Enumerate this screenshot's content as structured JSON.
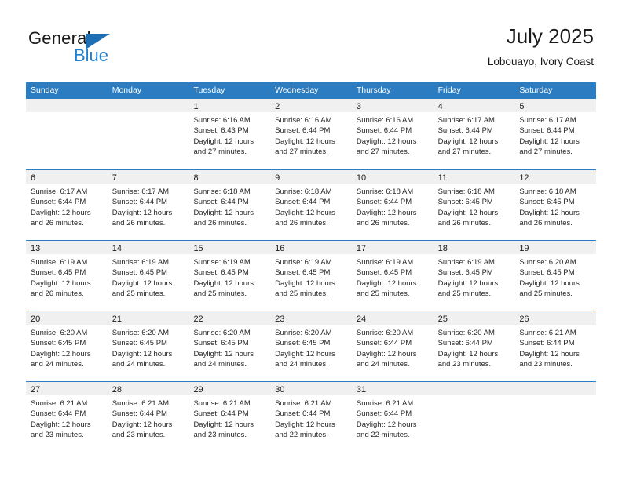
{
  "brand": {
    "name_top": "General",
    "name_bottom": "Blue",
    "triangle_icon": "triangle-icon",
    "color_black": "#1a1a1a",
    "color_blue": "#1f7fd0"
  },
  "header": {
    "title": "July 2025",
    "subtitle": "Lobouayo, Ivory Coast"
  },
  "theme": {
    "header_blue": "#2b7cc0",
    "day_band_gray": "#f0f0f0",
    "text": "#262626"
  },
  "calendar": {
    "weekdays": [
      "Sunday",
      "Monday",
      "Tuesday",
      "Wednesday",
      "Thursday",
      "Friday",
      "Saturday"
    ],
    "weeks": [
      [
        {
          "day": "",
          "lines": []
        },
        {
          "day": "",
          "lines": []
        },
        {
          "day": "1",
          "lines": [
            "Sunrise: 6:16 AM",
            "Sunset: 6:43 PM",
            "Daylight: 12 hours",
            "and 27 minutes."
          ]
        },
        {
          "day": "2",
          "lines": [
            "Sunrise: 6:16 AM",
            "Sunset: 6:44 PM",
            "Daylight: 12 hours",
            "and 27 minutes."
          ]
        },
        {
          "day": "3",
          "lines": [
            "Sunrise: 6:16 AM",
            "Sunset: 6:44 PM",
            "Daylight: 12 hours",
            "and 27 minutes."
          ]
        },
        {
          "day": "4",
          "lines": [
            "Sunrise: 6:17 AM",
            "Sunset: 6:44 PM",
            "Daylight: 12 hours",
            "and 27 minutes."
          ]
        },
        {
          "day": "5",
          "lines": [
            "Sunrise: 6:17 AM",
            "Sunset: 6:44 PM",
            "Daylight: 12 hours",
            "and 27 minutes."
          ]
        }
      ],
      [
        {
          "day": "6",
          "lines": [
            "Sunrise: 6:17 AM",
            "Sunset: 6:44 PM",
            "Daylight: 12 hours",
            "and 26 minutes."
          ]
        },
        {
          "day": "7",
          "lines": [
            "Sunrise: 6:17 AM",
            "Sunset: 6:44 PM",
            "Daylight: 12 hours",
            "and 26 minutes."
          ]
        },
        {
          "day": "8",
          "lines": [
            "Sunrise: 6:18 AM",
            "Sunset: 6:44 PM",
            "Daylight: 12 hours",
            "and 26 minutes."
          ]
        },
        {
          "day": "9",
          "lines": [
            "Sunrise: 6:18 AM",
            "Sunset: 6:44 PM",
            "Daylight: 12 hours",
            "and 26 minutes."
          ]
        },
        {
          "day": "10",
          "lines": [
            "Sunrise: 6:18 AM",
            "Sunset: 6:44 PM",
            "Daylight: 12 hours",
            "and 26 minutes."
          ]
        },
        {
          "day": "11",
          "lines": [
            "Sunrise: 6:18 AM",
            "Sunset: 6:45 PM",
            "Daylight: 12 hours",
            "and 26 minutes."
          ]
        },
        {
          "day": "12",
          "lines": [
            "Sunrise: 6:18 AM",
            "Sunset: 6:45 PM",
            "Daylight: 12 hours",
            "and 26 minutes."
          ]
        }
      ],
      [
        {
          "day": "13",
          "lines": [
            "Sunrise: 6:19 AM",
            "Sunset: 6:45 PM",
            "Daylight: 12 hours",
            "and 26 minutes."
          ]
        },
        {
          "day": "14",
          "lines": [
            "Sunrise: 6:19 AM",
            "Sunset: 6:45 PM",
            "Daylight: 12 hours",
            "and 25 minutes."
          ]
        },
        {
          "day": "15",
          "lines": [
            "Sunrise: 6:19 AM",
            "Sunset: 6:45 PM",
            "Daylight: 12 hours",
            "and 25 minutes."
          ]
        },
        {
          "day": "16",
          "lines": [
            "Sunrise: 6:19 AM",
            "Sunset: 6:45 PM",
            "Daylight: 12 hours",
            "and 25 minutes."
          ]
        },
        {
          "day": "17",
          "lines": [
            "Sunrise: 6:19 AM",
            "Sunset: 6:45 PM",
            "Daylight: 12 hours",
            "and 25 minutes."
          ]
        },
        {
          "day": "18",
          "lines": [
            "Sunrise: 6:19 AM",
            "Sunset: 6:45 PM",
            "Daylight: 12 hours",
            "and 25 minutes."
          ]
        },
        {
          "day": "19",
          "lines": [
            "Sunrise: 6:20 AM",
            "Sunset: 6:45 PM",
            "Daylight: 12 hours",
            "and 25 minutes."
          ]
        }
      ],
      [
        {
          "day": "20",
          "lines": [
            "Sunrise: 6:20 AM",
            "Sunset: 6:45 PM",
            "Daylight: 12 hours",
            "and 24 minutes."
          ]
        },
        {
          "day": "21",
          "lines": [
            "Sunrise: 6:20 AM",
            "Sunset: 6:45 PM",
            "Daylight: 12 hours",
            "and 24 minutes."
          ]
        },
        {
          "day": "22",
          "lines": [
            "Sunrise: 6:20 AM",
            "Sunset: 6:45 PM",
            "Daylight: 12 hours",
            "and 24 minutes."
          ]
        },
        {
          "day": "23",
          "lines": [
            "Sunrise: 6:20 AM",
            "Sunset: 6:45 PM",
            "Daylight: 12 hours",
            "and 24 minutes."
          ]
        },
        {
          "day": "24",
          "lines": [
            "Sunrise: 6:20 AM",
            "Sunset: 6:44 PM",
            "Daylight: 12 hours",
            "and 24 minutes."
          ]
        },
        {
          "day": "25",
          "lines": [
            "Sunrise: 6:20 AM",
            "Sunset: 6:44 PM",
            "Daylight: 12 hours",
            "and 23 minutes."
          ]
        },
        {
          "day": "26",
          "lines": [
            "Sunrise: 6:21 AM",
            "Sunset: 6:44 PM",
            "Daylight: 12 hours",
            "and 23 minutes."
          ]
        }
      ],
      [
        {
          "day": "27",
          "lines": [
            "Sunrise: 6:21 AM",
            "Sunset: 6:44 PM",
            "Daylight: 12 hours",
            "and 23 minutes."
          ]
        },
        {
          "day": "28",
          "lines": [
            "Sunrise: 6:21 AM",
            "Sunset: 6:44 PM",
            "Daylight: 12 hours",
            "and 23 minutes."
          ]
        },
        {
          "day": "29",
          "lines": [
            "Sunrise: 6:21 AM",
            "Sunset: 6:44 PM",
            "Daylight: 12 hours",
            "and 23 minutes."
          ]
        },
        {
          "day": "30",
          "lines": [
            "Sunrise: 6:21 AM",
            "Sunset: 6:44 PM",
            "Daylight: 12 hours",
            "and 22 minutes."
          ]
        },
        {
          "day": "31",
          "lines": [
            "Sunrise: 6:21 AM",
            "Sunset: 6:44 PM",
            "Daylight: 12 hours",
            "and 22 minutes."
          ]
        },
        {
          "day": "",
          "lines": []
        },
        {
          "day": "",
          "lines": []
        }
      ]
    ]
  }
}
